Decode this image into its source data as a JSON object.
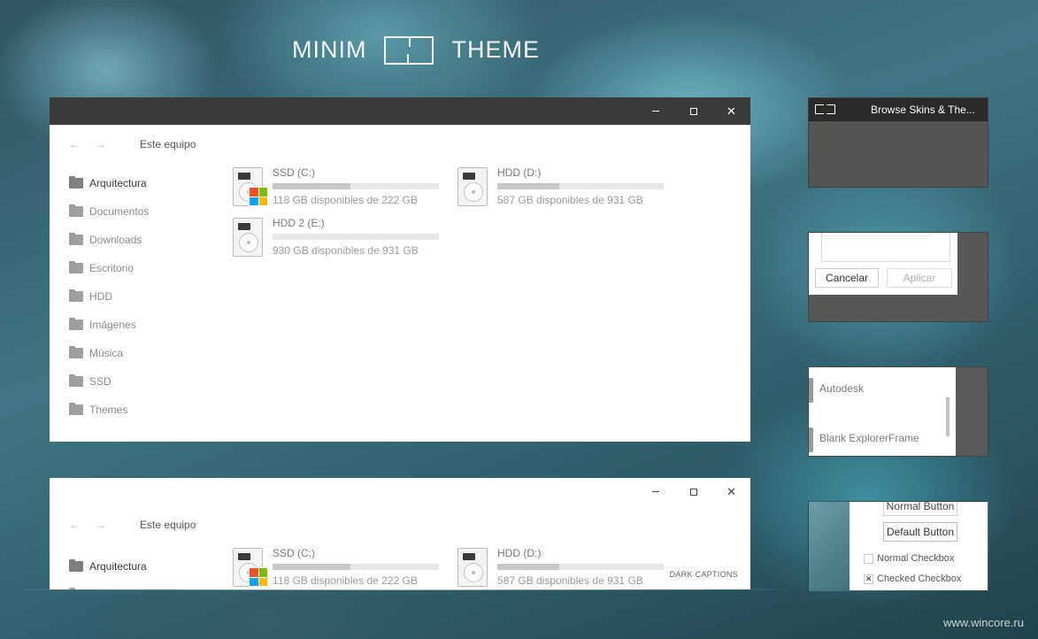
{
  "header": {
    "left_word": "MINIM",
    "right_word": "THEME"
  },
  "explorer": {
    "caption_buttons": {
      "minimize": "—",
      "maximize": "□",
      "close": "✕"
    },
    "nav": {
      "back": "←",
      "forward": "→",
      "path": "Este equipo"
    },
    "sidebar": [
      {
        "label": "Arquitectura",
        "icon": "folder-icon"
      },
      {
        "label": "Documentos",
        "icon": "folder-icon"
      },
      {
        "label": "Downloads",
        "icon": "folder-icon"
      },
      {
        "label": "Escritorio",
        "icon": "folder-icon"
      },
      {
        "label": "HDD",
        "icon": "folder-icon"
      },
      {
        "label": "Imágenes",
        "icon": "folder-icon"
      },
      {
        "label": "Música",
        "icon": "folder-icon"
      },
      {
        "label": "SSD",
        "icon": "folder-icon"
      },
      {
        "label": "Themes",
        "icon": "folder-icon"
      }
    ],
    "drives": [
      {
        "name": "SSD (C:)",
        "free": "118 GB disponibles de 222 GB",
        "used_fraction": 0.47,
        "system": true
      },
      {
        "name": "HDD (D:)",
        "free": "587 GB disponibles de 931 GB",
        "used_fraction": 0.37,
        "system": false
      },
      {
        "name": "HDD 2 (E:)",
        "free": "930 GB disponibles de 931 GB",
        "used_fraction": 0.0,
        "system": false
      }
    ],
    "dark_captions_label": "DARK CAPTIONS"
  },
  "previews": {
    "browse_title": "Browse Skins & The...",
    "dialog": {
      "cancel": "Cancelar",
      "apply": "Aplicar"
    },
    "list": {
      "item1": "Autodesk",
      "item2": "Blank ExplorerFrame"
    },
    "controls": {
      "normal_button": "Normal Button",
      "default_button": "Default Button",
      "normal_checkbox": "Normal Checkbox",
      "checked_checkbox": "Checked Checkbox",
      "check_mark": "✕"
    }
  },
  "watermark": "www.wincore.ru",
  "colors": {
    "dark_titlebar": "#3b3b3b",
    "window_bg": "#ffffff",
    "bar_fill": "#c8c8c8",
    "bar_track": "#e8e8e8"
  }
}
